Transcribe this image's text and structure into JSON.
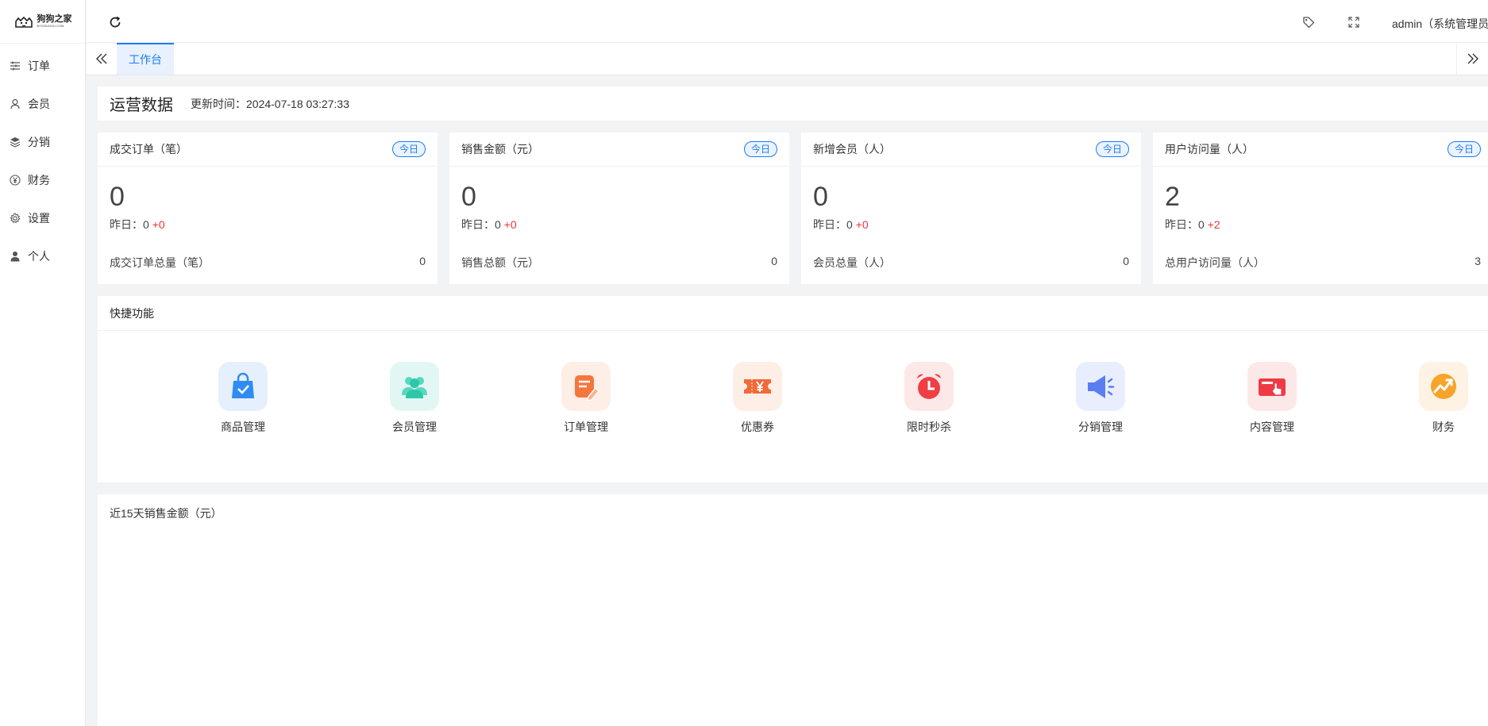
{
  "logo": {
    "name": "狗狗之家",
    "subtitle": "BYGOUGOU.COM"
  },
  "sidebar": {
    "items": [
      {
        "label": "订单",
        "icon": "list-icon"
      },
      {
        "label": "会员",
        "icon": "user-icon"
      },
      {
        "label": "分销",
        "icon": "layers-icon"
      },
      {
        "label": "财务",
        "icon": "yen-icon"
      },
      {
        "label": "设置",
        "icon": "gear-icon"
      },
      {
        "label": "个人",
        "icon": "person-icon"
      }
    ]
  },
  "topbar": {
    "user": "admin（系统管理员）"
  },
  "tabs": {
    "active": "工作台"
  },
  "ops": {
    "title": "运营数据",
    "updated_label": "更新时间：",
    "updated_time": "2024-07-18 03:27:33"
  },
  "stats": [
    {
      "title": "成交订单（笔）",
      "badge": "今日",
      "value": "0",
      "yday_label": "昨日：",
      "yday_value": "0",
      "delta": "+0",
      "total_label": "成交订单总量（笔）",
      "total": "0"
    },
    {
      "title": "销售金额（元）",
      "badge": "今日",
      "value": "0",
      "yday_label": "昨日：",
      "yday_value": "0",
      "delta": "+0",
      "total_label": "销售总额（元）",
      "total": "0"
    },
    {
      "title": "新增会员（人）",
      "badge": "今日",
      "value": "0",
      "yday_label": "昨日：",
      "yday_value": "0",
      "delta": "+0",
      "total_label": "会员总量（人）",
      "total": "0"
    },
    {
      "title": "用户访问量（人）",
      "badge": "今日",
      "value": "2",
      "yday_label": "昨日：",
      "yday_value": "0",
      "delta": "+2",
      "total_label": "总用户访问量（人）",
      "total": "3"
    }
  ],
  "quick": {
    "title": "快捷功能",
    "items": [
      {
        "label": "商品管理",
        "icon": "shopping-bag-icon",
        "bg": "#e6f0fd",
        "color": "#2f8cf5"
      },
      {
        "label": "会员管理",
        "icon": "members-icon",
        "bg": "#e2f7f3",
        "color": "#2cc7a9"
      },
      {
        "label": "订单管理",
        "icon": "order-edit-icon",
        "bg": "#fdeee6",
        "color": "#f4773f"
      },
      {
        "label": "优惠券",
        "icon": "coupon-icon",
        "bg": "#fdeee6",
        "color": "#f2693a"
      },
      {
        "label": "限时秒杀",
        "icon": "alarm-clock-icon",
        "bg": "#fde8e8",
        "color": "#ef3f45"
      },
      {
        "label": "分销管理",
        "icon": "megaphone-icon",
        "bg": "#e8eefd",
        "color": "#5a7ef2"
      },
      {
        "label": "内容管理",
        "icon": "card-hand-icon",
        "bg": "#fde8e8",
        "color": "#ef3a44"
      },
      {
        "label": "财务",
        "icon": "finance-icon",
        "bg": "#fdf2e4",
        "color": "#f6a52a"
      }
    ]
  },
  "sales": {
    "title": "近15天销售金额（元）"
  },
  "colors": {
    "primary": "#1e7cf2",
    "delta": "#e4393c"
  }
}
